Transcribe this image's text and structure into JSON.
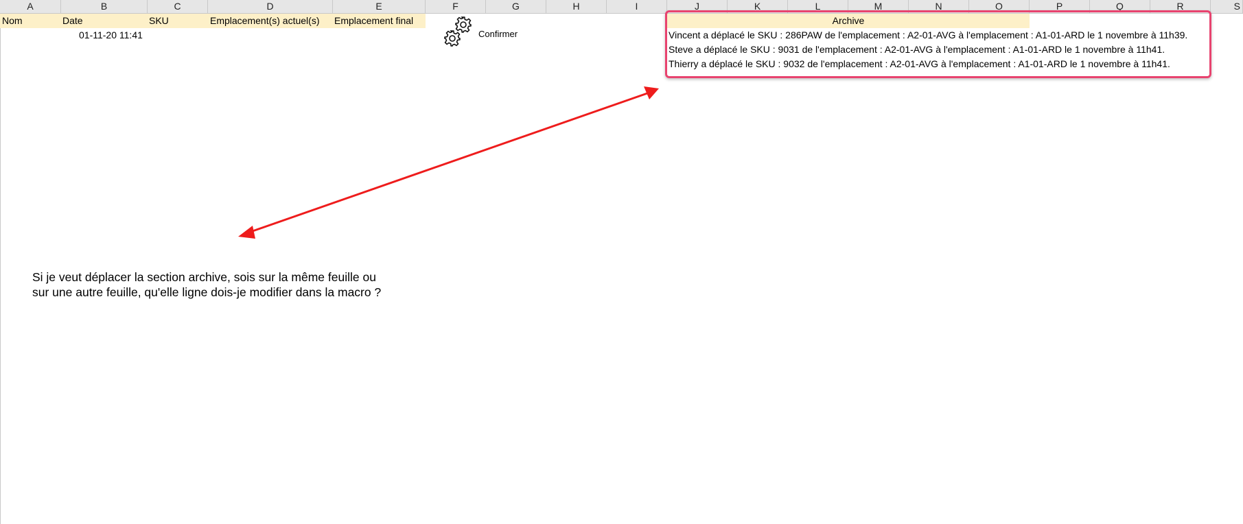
{
  "columns": [
    "A",
    "B",
    "C",
    "D",
    "E",
    "F",
    "G",
    "H",
    "I",
    "J",
    "K",
    "L",
    "M",
    "N",
    "O",
    "P",
    "Q",
    "R",
    "S"
  ],
  "headers": {
    "nom": "Nom",
    "date": "Date",
    "sku": "SKU",
    "current_location": "Emplacement(s) actuel(s)",
    "final_location": "Emplacement final",
    "archive": "Archive"
  },
  "row1": {
    "date_value": "01-11-20 11:41"
  },
  "confirm_button": {
    "label": "Confirmer",
    "icon": "gear-icon"
  },
  "archive_lines": [
    "Vincent a déplacé le SKU : 286PAW de l'emplacement : A2-01-AVG à l'emplacement : A1-01-ARD le 1 novembre à 11h39.",
    "Steve a déplacé le SKU : 9031 de l'emplacement : A2-01-AVG à l'emplacement : A1-01-ARD le 1 novembre à 11h41.",
    "Thierry a déplacé le SKU : 9032 de l'emplacement : A2-01-AVG à l'emplacement : A1-01-ARD le 1 novembre à 11h41."
  ],
  "annotation": {
    "note": "Si je veut déplacer la section archive, sois sur la même feuille ou sur une autre feuille, qu'elle ligne dois-je modifier dans la macro ?",
    "frame_color": "#e8436f",
    "arrow_color": "#ee1c1c"
  }
}
